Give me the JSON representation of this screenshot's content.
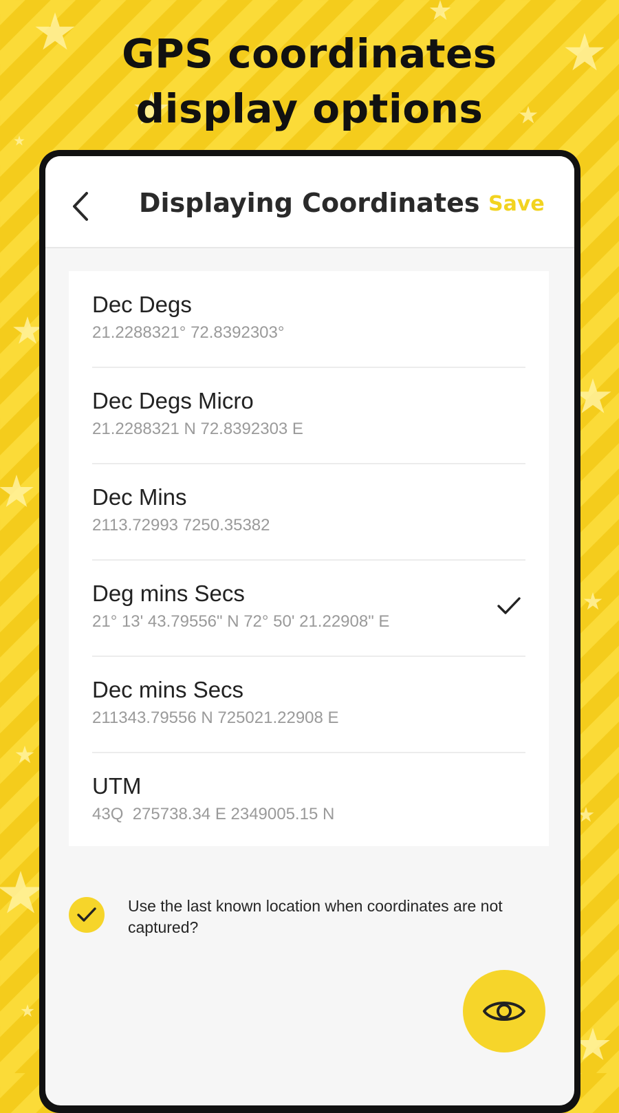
{
  "promo": {
    "headline_line1": "GPS coordinates",
    "headline_line2": "display options"
  },
  "appbar": {
    "back_icon": "chevron-left-icon",
    "title": "Displaying Coordinates",
    "save_label": "Save",
    "save_color": "#f2d320"
  },
  "options": [
    {
      "label": "Dec Degs",
      "value": "21.2288321° 72.8392303°",
      "selected": false
    },
    {
      "label": "Dec Degs Micro",
      "value": "21.2288321 N 72.8392303 E",
      "selected": false
    },
    {
      "label": "Dec Mins",
      "value": "2113.72993 7250.35382",
      "selected": false
    },
    {
      "label": "Deg mins Secs",
      "value": "21° 13' 43.79556\" N 72° 50' 21.22908\" E",
      "selected": true
    },
    {
      "label": "Dec mins Secs",
      "value": "211343.79556 N 725021.22908 E",
      "selected": false
    },
    {
      "label": "UTM",
      "value": "43Q  275738.34 E 2349005.15 N",
      "selected": false
    }
  ],
  "selected_indicator_icon": "checkmark-icon",
  "last_known": {
    "checked": true,
    "text": "Use the last known location when coordinates are not captured?"
  },
  "fab": {
    "icon": "eye-icon"
  },
  "colors": {
    "accent": "#f6d52a",
    "background": "#f8d327",
    "title_text": "#2a2a2a",
    "secondary_text": "#9a9a9a"
  }
}
